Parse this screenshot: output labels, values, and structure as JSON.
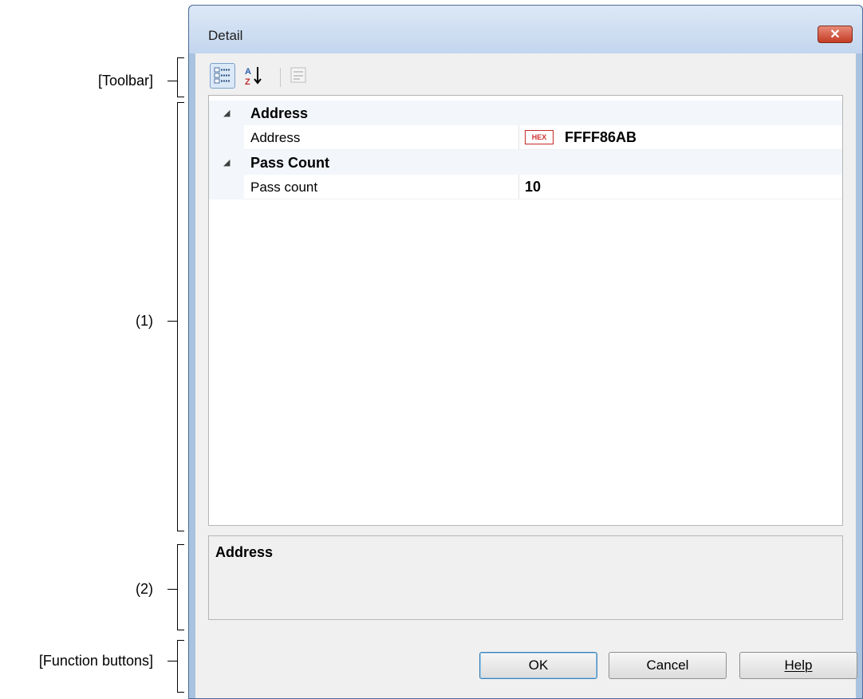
{
  "annotations": {
    "toolbar": "[Toolbar]",
    "area1": "(1)",
    "area2": "(2)",
    "function_buttons": "[Function buttons]"
  },
  "window": {
    "title": "Detail",
    "close_label": "✕"
  },
  "toolbar": {
    "buttons": [
      {
        "name": "categorized-view-icon",
        "active": true
      },
      {
        "name": "sort-alphabetical-icon",
        "active": false
      },
      {
        "name": "property-pages-icon",
        "active": false,
        "disabled": true
      }
    ]
  },
  "grid": {
    "categories": [
      {
        "label": "Address",
        "properties": [
          {
            "name": "Address",
            "value": "FFFF86AB",
            "badge": "HEX"
          }
        ]
      },
      {
        "label": "Pass Count",
        "properties": [
          {
            "name": "Pass count",
            "value": "10"
          }
        ]
      }
    ]
  },
  "description": {
    "title": "Address"
  },
  "buttons": {
    "ok": "OK",
    "cancel": "Cancel",
    "help": "Help"
  },
  "colors": {
    "accent": "#3c7fb1",
    "hex_badge": "#d03030",
    "close_button": "#c43c24"
  }
}
